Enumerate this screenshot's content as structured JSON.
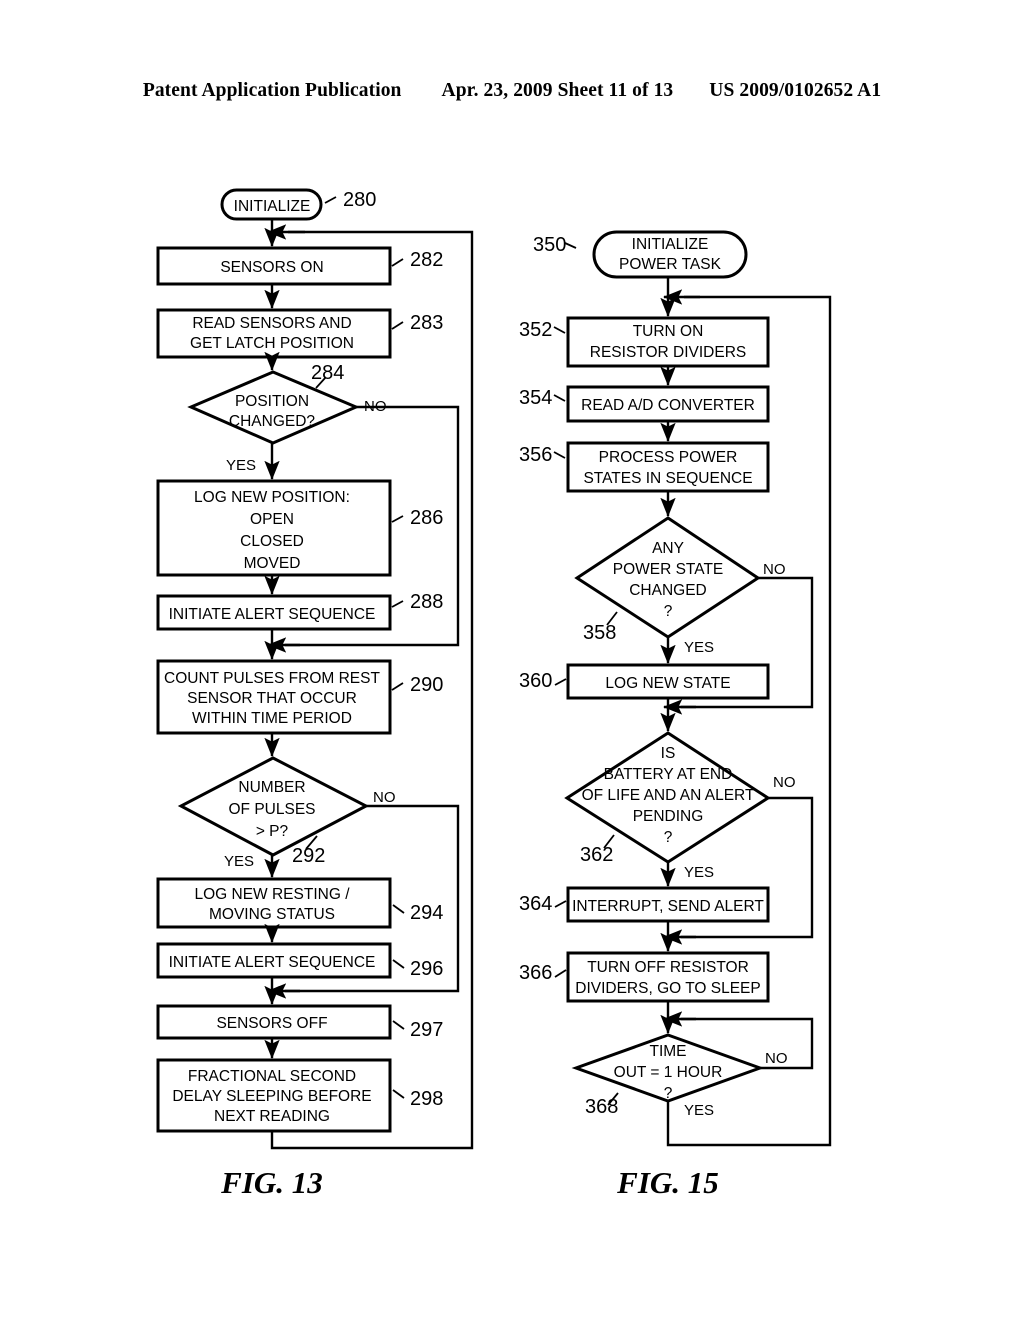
{
  "header": {
    "publication": "Patent Application Publication",
    "date_sheet": "Apr. 23, 2009  Sheet 11 of 13",
    "patent_number": "US 2009/0102652 A1"
  },
  "figures": [
    {
      "id": "fig13",
      "caption": "FIG. 13",
      "nodes": [
        {
          "ref": "280",
          "shape": "terminator",
          "lines": [
            "INITIALIZE"
          ]
        },
        {
          "ref": "282",
          "shape": "process",
          "lines": [
            "SENSORS ON"
          ]
        },
        {
          "ref": "283",
          "shape": "process",
          "lines": [
            "READ SENSORS AND",
            "GET LATCH POSITION"
          ]
        },
        {
          "ref": "284",
          "shape": "decision",
          "lines": [
            "POSITION",
            "CHANGED?"
          ],
          "yes": "YES",
          "no": "NO"
        },
        {
          "ref": "286",
          "shape": "process",
          "lines": [
            "LOG NEW POSITION:",
            "OPEN",
            "CLOSED",
            "MOVED"
          ]
        },
        {
          "ref": "288",
          "shape": "process",
          "lines": [
            "INITIATE ALERT SEQUENCE"
          ]
        },
        {
          "ref": "290",
          "shape": "process",
          "lines": [
            "COUNT PULSES FROM REST",
            "SENSOR THAT OCCUR",
            "WITHIN  TIME PERIOD"
          ]
        },
        {
          "ref": "292",
          "shape": "decision",
          "lines": [
            "NUMBER",
            "OF PULSES",
            "> P?"
          ],
          "yes": "YES",
          "no": "NO"
        },
        {
          "ref": "294",
          "shape": "process",
          "lines": [
            "LOG NEW RESTING /",
            "MOVING STATUS"
          ]
        },
        {
          "ref": "296",
          "shape": "process",
          "lines": [
            "INITIATE ALERT SEQUENCE"
          ]
        },
        {
          "ref": "297",
          "shape": "process",
          "lines": [
            "SENSORS OFF"
          ]
        },
        {
          "ref": "298",
          "shape": "process",
          "lines": [
            "FRACTIONAL SECOND",
            "DELAY SLEEPING BEFORE",
            "NEXT READING"
          ]
        }
      ]
    },
    {
      "id": "fig15",
      "caption": "FIG. 15",
      "nodes": [
        {
          "ref": "350",
          "shape": "terminator",
          "lines": [
            "INITIALIZE",
            "POWER TASK"
          ]
        },
        {
          "ref": "352",
          "shape": "process",
          "lines": [
            "TURN ON",
            "RESISTOR DIVIDERS"
          ]
        },
        {
          "ref": "354",
          "shape": "process",
          "lines": [
            "READ A/D CONVERTER"
          ]
        },
        {
          "ref": "356",
          "shape": "process",
          "lines": [
            "PROCESS POWER",
            "STATES IN SEQUENCE"
          ]
        },
        {
          "ref": "358",
          "shape": "decision",
          "lines": [
            "ANY",
            "POWER STATE",
            "CHANGED",
            "?"
          ],
          "yes": "YES",
          "no": "NO"
        },
        {
          "ref": "360",
          "shape": "process",
          "lines": [
            "LOG NEW STATE"
          ]
        },
        {
          "ref": "362",
          "shape": "decision",
          "lines": [
            "IS",
            "BATTERY AT END",
            "OF LIFE AND AN ALERT",
            "PENDING",
            "?"
          ],
          "yes": "YES",
          "no": "NO"
        },
        {
          "ref": "364",
          "shape": "process",
          "lines": [
            "INTERRUPT, SEND ALERT"
          ]
        },
        {
          "ref": "366",
          "shape": "process",
          "lines": [
            "TURN OFF RESISTOR",
            "DIVIDERS, GO TO SLEEP"
          ]
        },
        {
          "ref": "368",
          "shape": "decision",
          "lines": [
            "TIME",
            "OUT = 1 HOUR",
            "?"
          ],
          "yes": "YES",
          "no": "NO"
        }
      ]
    }
  ],
  "colors": {
    "ink": "#000000",
    "paper": "#ffffff"
  }
}
